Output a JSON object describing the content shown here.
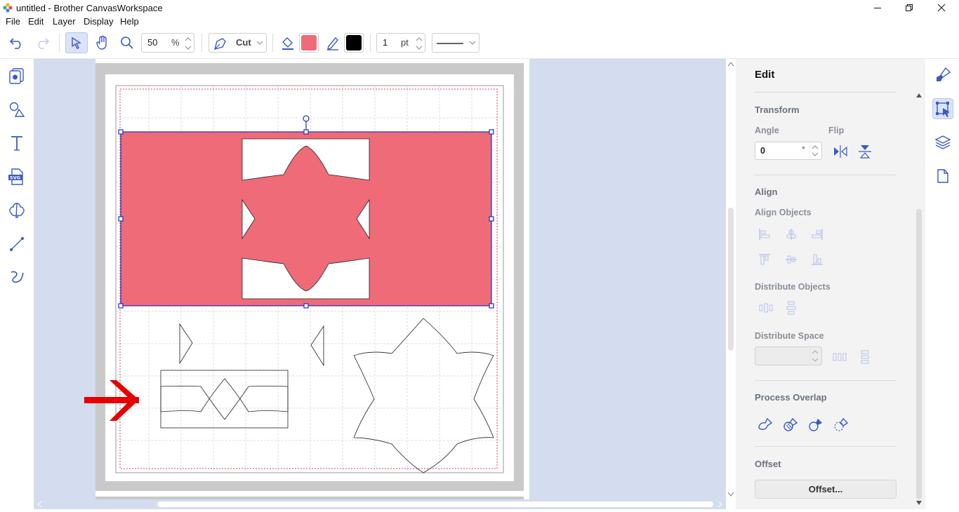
{
  "window": {
    "title": "untitled - Brother CanvasWorkspace"
  },
  "menu": {
    "items": [
      "File",
      "Edit",
      "Layer",
      "Display",
      "Help"
    ]
  },
  "toolbar": {
    "zoom_value": "50",
    "zoom_unit": "%",
    "mode_label": "Cut",
    "fill_color": "#ef6b78",
    "stroke_color": "#000000",
    "line_width_value": "1",
    "line_width_unit": "pt"
  },
  "panel": {
    "title": "Edit",
    "transform": {
      "heading": "Transform",
      "angle_label": "Angle",
      "angle_value": "0",
      "angle_unit": "°",
      "flip_label": "Flip"
    },
    "align": {
      "heading": "Align",
      "align_objects_label": "Align Objects",
      "distribute_objects_label": "Distribute Objects",
      "distribute_space_label": "Distribute Space"
    },
    "process_overlap": {
      "heading": "Process Overlap"
    },
    "offset": {
      "heading": "Offset",
      "button_label": "Offset..."
    }
  },
  "colors": {
    "accent": "#3a5ac8",
    "selection": "#1f2fbf",
    "canvas_bg": "#d4dcf0",
    "shape_fill": "#ef6b78",
    "annotation_arrow": "#e60000"
  }
}
